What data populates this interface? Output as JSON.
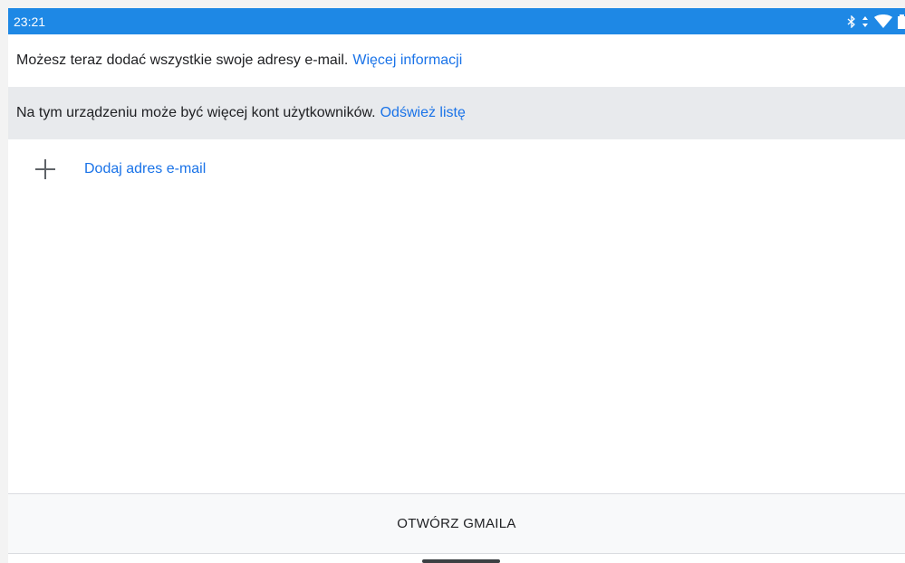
{
  "status_bar": {
    "time": "23:21",
    "icons": [
      "bluetooth-icon",
      "data-arrows-icon",
      "wifi-icon",
      "battery-icon"
    ]
  },
  "info_row": {
    "text": "Możesz teraz dodać wszystkie swoje adresy e-mail.",
    "link": "Więcej informacji"
  },
  "notice_row": {
    "text": "Na tym urządzeniu może być więcej kont użytkowników.",
    "link": "Odśwież listę"
  },
  "add_email": {
    "icon": "plus-icon",
    "label": "Dodaj adres e-mail"
  },
  "bottom": {
    "button_label": "OTWÓRZ GMAILA"
  },
  "colors": {
    "status_bar": "#1e88e5",
    "link": "#1a73e8",
    "notice_bg": "#e8eaed"
  }
}
